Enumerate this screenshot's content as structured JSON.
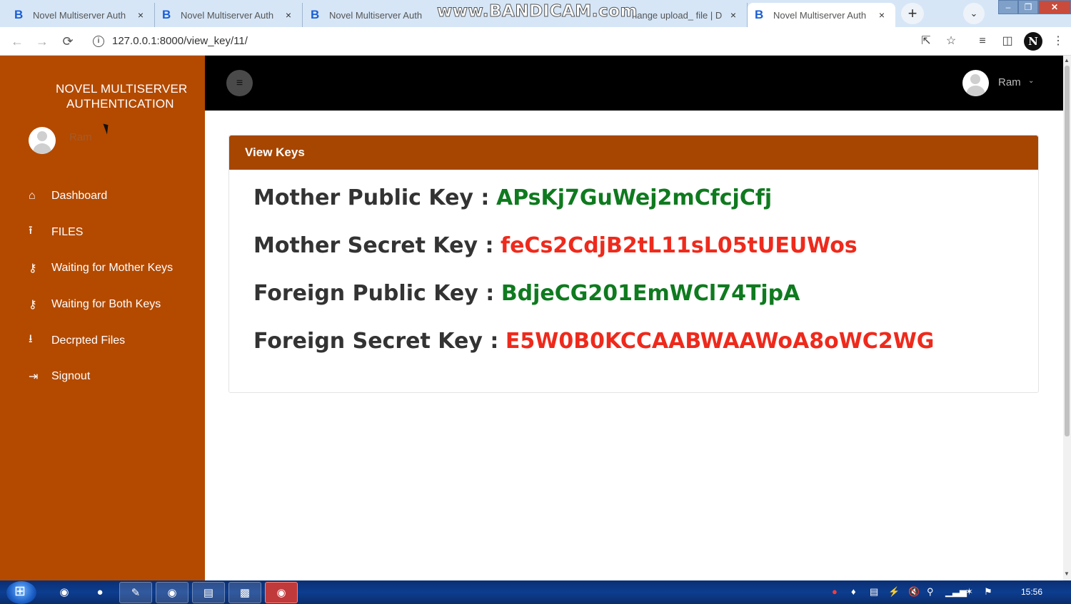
{
  "browser": {
    "tabs": [
      {
        "title": "Novel Multiserver Auth",
        "close": "×"
      },
      {
        "title": "Novel Multiserver Auth",
        "close": "×"
      },
      {
        "title": "Novel Multiserver Auth",
        "close": ""
      },
      {
        "title": "hange upload_ file | D",
        "close": "×"
      },
      {
        "title": "Novel Multiserver Auth",
        "close": "×"
      }
    ],
    "tab_logo": "B",
    "new_tab": "+",
    "url": "127.0.0.1:8000/view_key/11/",
    "profile_letter": "N",
    "watermark": "www.BANDICAM.com"
  },
  "app": {
    "brand_line1": "NOVEL MULTISERVER",
    "brand_line2": "AUTHENTICATION",
    "sidebar_user": "Ram",
    "top_user": "Ram",
    "menu": [
      {
        "label": "Dashboard",
        "icon": "home-icon",
        "glyph": "⌂"
      },
      {
        "label": "FILES",
        "icon": "upload-icon",
        "glyph": "⭱"
      },
      {
        "label": "Waiting for Mother Keys",
        "icon": "key-icon",
        "glyph": "⚷"
      },
      {
        "label": "Waiting for Both Keys",
        "icon": "keys-icon",
        "glyph": "⚷"
      },
      {
        "label": "Decrpted Files",
        "icon": "download-icon",
        "glyph": "⭳"
      },
      {
        "label": "Signout",
        "icon": "signout-icon",
        "glyph": "⇥"
      }
    ],
    "card_title": "View Keys",
    "keys": [
      {
        "label": "Mother Public Key :",
        "value": "APsKj7GuWej2mCfcjCfj",
        "color": "#0f7a1f"
      },
      {
        "label": "Mother Secret Key :",
        "value": "feCs2CdjB2tL11sL05tUEUWos",
        "color": "#ee2a1c"
      },
      {
        "label": "Foreign Public Key :",
        "value": "BdjeCG201EmWCl74TjpA",
        "color": "#0f7a1f"
      },
      {
        "label": "Foreign Secret Key :",
        "value": "E5W0B0KCCAABWAAWoA8oWC2WG",
        "color": "#ee2a1c"
      }
    ],
    "colors": {
      "sidebar": "#b34a00",
      "card_header": "#a64600",
      "topbar": "#000000"
    }
  },
  "taskbar": {
    "clock": "15:56"
  }
}
